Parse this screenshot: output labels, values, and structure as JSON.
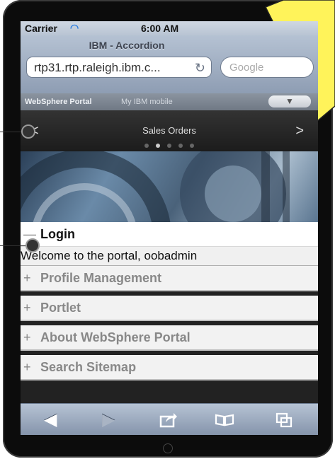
{
  "status": {
    "carrier": "Carrier",
    "time": "6:00 AM"
  },
  "browser": {
    "title": "IBM - Accordion",
    "url": "rtp31.rtp.raleigh.ibm.c...",
    "search_placeholder": "Google"
  },
  "portal_bar": {
    "brand": "WebSphere Portal",
    "subtitle": "My IBM mobile"
  },
  "nav": {
    "title": "Sales Orders",
    "dot_count": 5,
    "active_dot": 1
  },
  "accordion": {
    "open_section": {
      "label": "Login",
      "content": "Welcome to the portal, oobadmin"
    },
    "sections": [
      {
        "label": "Profile Management"
      },
      {
        "label": "Portlet"
      },
      {
        "label": "About WebSphere Portal"
      },
      {
        "label": "Search Sitemap"
      }
    ]
  },
  "toolbar": {
    "icons": [
      "back-icon",
      "forward-icon",
      "share-icon",
      "bookmarks-icon",
      "tabs-icon"
    ]
  },
  "colors": {
    "toolbar": "#8e9db3",
    "burst": "#fff35a",
    "frame": "#0c0c0c"
  }
}
